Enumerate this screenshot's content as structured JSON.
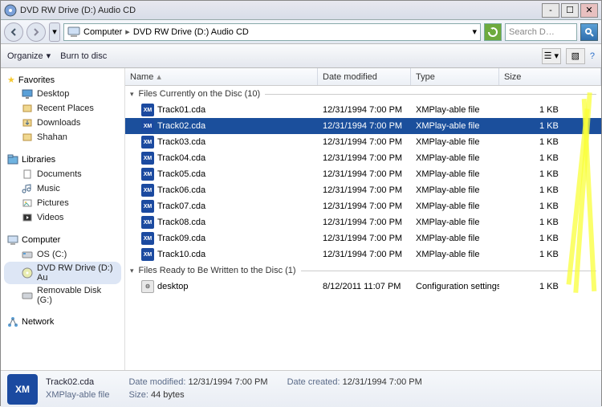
{
  "window": {
    "title": "DVD RW Drive (D:) Audio CD"
  },
  "breadcrumbs": {
    "root": "Computer",
    "loc": "DVD RW Drive (D:) Audio CD"
  },
  "search": {
    "placeholder": "Search D…"
  },
  "toolbar": {
    "organize": "Organize",
    "burn": "Burn to disc"
  },
  "sidebar": {
    "favorites": {
      "label": "Favorites",
      "items": [
        "Desktop",
        "Recent Places",
        "Downloads",
        "Shahan"
      ]
    },
    "libraries": {
      "label": "Libraries",
      "items": [
        "Documents",
        "Music",
        "Pictures",
        "Videos"
      ]
    },
    "computer": {
      "label": "Computer",
      "items": [
        "OS (C:)",
        "DVD RW Drive (D:) Au",
        "Removable Disk (G:)"
      ],
      "selectedIndex": 1
    },
    "network": {
      "label": "Network"
    }
  },
  "columns": {
    "name": "Name",
    "date": "Date modified",
    "type": "Type",
    "size": "Size"
  },
  "groups": {
    "current": {
      "label": "Files Currently on the Disc (10)"
    },
    "ready": {
      "label": "Files Ready to Be Written to the Disc (1)"
    }
  },
  "tracks": [
    {
      "name": "Track01.cda",
      "date": "12/31/1994 7:00 PM",
      "type": "XMPlay-able file",
      "size": "1 KB"
    },
    {
      "name": "Track02.cda",
      "date": "12/31/1994 7:00 PM",
      "type": "XMPlay-able file",
      "size": "1 KB"
    },
    {
      "name": "Track03.cda",
      "date": "12/31/1994 7:00 PM",
      "type": "XMPlay-able file",
      "size": "1 KB"
    },
    {
      "name": "Track04.cda",
      "date": "12/31/1994 7:00 PM",
      "type": "XMPlay-able file",
      "size": "1 KB"
    },
    {
      "name": "Track05.cda",
      "date": "12/31/1994 7:00 PM",
      "type": "XMPlay-able file",
      "size": "1 KB"
    },
    {
      "name": "Track06.cda",
      "date": "12/31/1994 7:00 PM",
      "type": "XMPlay-able file",
      "size": "1 KB"
    },
    {
      "name": "Track07.cda",
      "date": "12/31/1994 7:00 PM",
      "type": "XMPlay-able file",
      "size": "1 KB"
    },
    {
      "name": "Track08.cda",
      "date": "12/31/1994 7:00 PM",
      "type": "XMPlay-able file",
      "size": "1 KB"
    },
    {
      "name": "Track09.cda",
      "date": "12/31/1994 7:00 PM",
      "type": "XMPlay-able file",
      "size": "1 KB"
    },
    {
      "name": "Track10.cda",
      "date": "12/31/1994 7:00 PM",
      "type": "XMPlay-able file",
      "size": "1 KB"
    }
  ],
  "selectedTrack": 1,
  "ready": [
    {
      "name": "desktop",
      "date": "8/12/2011 11:07 PM",
      "type": "Configuration settings",
      "size": "1 KB"
    }
  ],
  "details": {
    "name": "Track02.cda",
    "type": "XMPlay-able file",
    "modLabel": "Date modified:",
    "mod": "12/31/1994 7:00 PM",
    "sizeLabel": "Size:",
    "size": "44 bytes",
    "createdLabel": "Date created:",
    "created": "12/31/1994 7:00 PM"
  }
}
